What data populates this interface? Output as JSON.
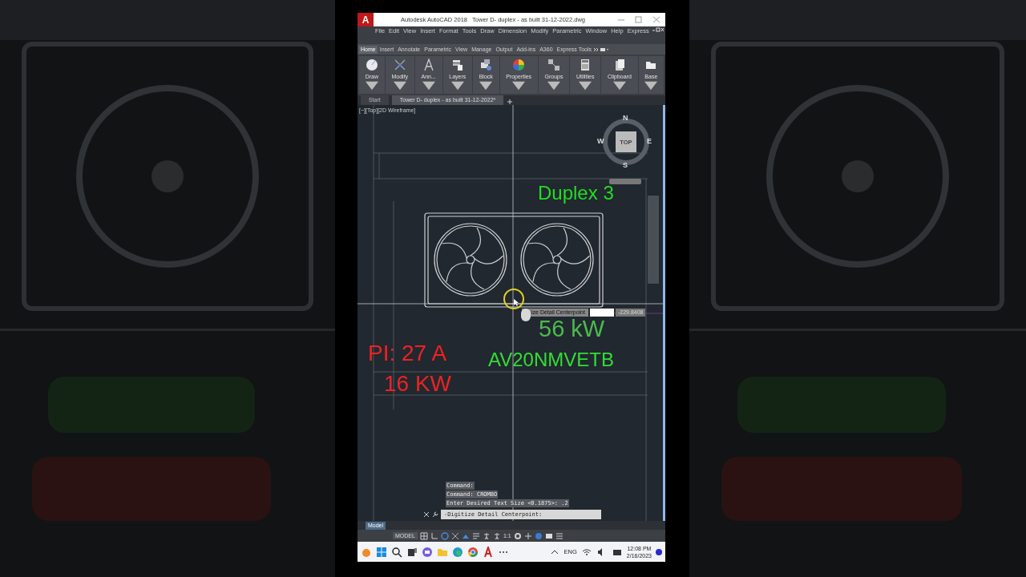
{
  "title_bar": {
    "app_menu": "A",
    "title": "Autodesk AutoCAD 2018   Tower D- duplex - as built 31-12-2022.dwg"
  },
  "menu_bar": [
    "File",
    "Edit",
    "View",
    "Insert",
    "Format",
    "Tools",
    "Draw",
    "Dimension",
    "Modify",
    "Parametric",
    "Window",
    "Help",
    "Express"
  ],
  "ribbon_tabs": [
    {
      "label": "Home",
      "selected": true
    },
    {
      "label": "Insert",
      "selected": false
    },
    {
      "label": "Annotate",
      "selected": false
    },
    {
      "label": "Parametric",
      "selected": false
    },
    {
      "label": "View",
      "selected": false
    },
    {
      "label": "Manage",
      "selected": false
    },
    {
      "label": "Output",
      "selected": false
    },
    {
      "label": "Add-ins",
      "selected": false
    },
    {
      "label": "A360",
      "selected": false
    },
    {
      "label": "Express Tools",
      "selected": false
    }
  ],
  "ribbon_panels": [
    "Draw",
    "Modify",
    "Ann...",
    "Layers",
    "Block",
    "Properties",
    "Groups",
    "Utilities",
    "Clipboard",
    "Base"
  ],
  "file_tabs": [
    {
      "label": "Start",
      "selected": false
    },
    {
      "label": "Tower D- duplex - as built 31-12-2022*",
      "selected": true
    }
  ],
  "viewport": {
    "label": "[−][Top][2D Wireframe]",
    "viewcube": {
      "north": "N",
      "south": "S",
      "east": "E",
      "west": "W",
      "face": "TOP"
    },
    "annotations": [
      {
        "text": "Duplex 3",
        "color": "#22dd22"
      },
      {
        "text": "56 kW",
        "color": "#4cbb4c"
      },
      {
        "text": "PI: 27 A",
        "color": "#ee2222"
      },
      {
        "text": "AV20NMVETB",
        "color": "#33dd33"
      },
      {
        "text": "16 KW",
        "color": "#ee2222"
      }
    ],
    "tooltip": {
      "prompt": "ize Detail Centerpoint",
      "value": "-229.8408"
    }
  },
  "command_history": [
    "Command:",
    "Command: CROMBO",
    "Enter Desired Text Size <0.1875>: .2"
  ],
  "command_line": {
    "value": "-Digitize Detail Centerpoint:"
  },
  "layout_tabs": [
    {
      "label": "Model",
      "selected": true
    }
  ],
  "status_bar": {
    "model": "MODEL",
    "scale": "1:1"
  },
  "taskbar": {
    "language": "ENG",
    "time": "12:08 PM",
    "date": "2/16/2023"
  }
}
